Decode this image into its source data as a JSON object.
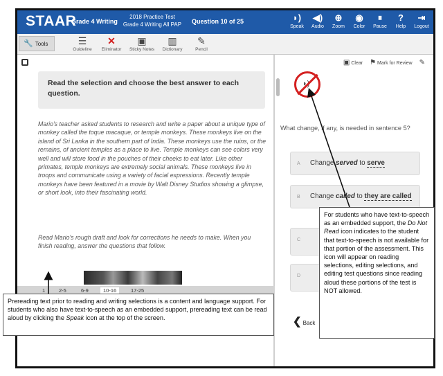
{
  "header": {
    "logo": "STAAR",
    "grade": "Grade 4 Writing",
    "test_line1": "2018 Practice Test",
    "test_line2": "Grade 4 Writing All PAP",
    "question": "Question 10 of 25",
    "icons": [
      {
        "name": "speak-icon",
        "glyph": "◗)",
        "label": "Speak"
      },
      {
        "name": "audio-icon",
        "glyph": "◀)",
        "label": "Audio"
      },
      {
        "name": "zoom-icon",
        "glyph": "⊕",
        "label": "Zoom"
      },
      {
        "name": "color-icon",
        "glyph": "◉",
        "label": "Color"
      },
      {
        "name": "pause-icon",
        "glyph": "⏸",
        "label": "Pause"
      },
      {
        "name": "help-icon",
        "glyph": "?",
        "label": "Help"
      },
      {
        "name": "logout-icon",
        "glyph": "⇥",
        "label": "Logout"
      }
    ]
  },
  "toolbar": {
    "tools_label": "Tools",
    "items": [
      {
        "name": "guideline-tool",
        "glyph": "☰",
        "label": "Guideline"
      },
      {
        "name": "eliminator-tool",
        "glyph": "✕",
        "label": "Eliminator"
      },
      {
        "name": "sticky-notes-tool",
        "glyph": "▣",
        "label": "Sticky Notes"
      },
      {
        "name": "dictionary-tool",
        "glyph": "▥",
        "label": "Dictionary"
      },
      {
        "name": "pencil-tool",
        "glyph": "✎",
        "label": "Pencil"
      }
    ]
  },
  "passage": {
    "instructions": "Read the selection and choose the best answer to each question.",
    "paragraph1": "Mario's teacher asked students to research and write a paper about a unique type of monkey called the toque macaque, or temple monkeys. These monkeys live on the island of Sri Lanka in the southern part of India. These monkeys use the ruins, or the remains, of ancient temples as a place to live. Temple monkeys can see colors very well and will store food in the pouches of their cheeks to eat later. Like other primates, temple monkeys are extremely social animals. These monkeys live in troops and communicate using a variety of facial expressions. Recently temple monkeys have been featured in a movie by Walt Disney Studios showing a glimpse, or short look, into their fascinating world.",
    "paragraph2": "Read Mario's rough draft and look for corrections he needs to make. When you finish reading, answer the questions that follow.",
    "pages": [
      "1",
      "2-5",
      "6-9",
      "10-16",
      "17-25"
    ]
  },
  "question_panel": {
    "clear_label": "Clear",
    "mark_label": "Mark for Review",
    "question_text": "What change, if any, is needed in sentence 5?",
    "choices": [
      {
        "letter": "A",
        "pre": "Change ",
        "from": "served",
        "mid": " to ",
        "to": "serve"
      },
      {
        "letter": "B",
        "pre": "Change ",
        "from": "called",
        "mid": " to ",
        "to": "they are called"
      },
      {
        "letter": "C",
        "text": ""
      },
      {
        "letter": "D",
        "text": ""
      }
    ],
    "back_label": "Back"
  },
  "callouts": {
    "left_p1": "Prereading text prior to reading and writing selections is a content and language support. For students who also have text-to-speech as an embedded support, prereading text can be read aloud by clicking the ",
    "left_em": "Speak",
    "left_p2": " icon at the top of the screen.",
    "right_p1": "For students who have text-to-speech as an embedded support, the ",
    "right_em": "Do Not Read",
    "right_p2": " icon indicates to the student that text-to-speech is not available for that portion of the assessment. This icon will appear on reading selections, editing selections, and editing test questions since reading aloud these portions of the test is NOT allowed."
  }
}
